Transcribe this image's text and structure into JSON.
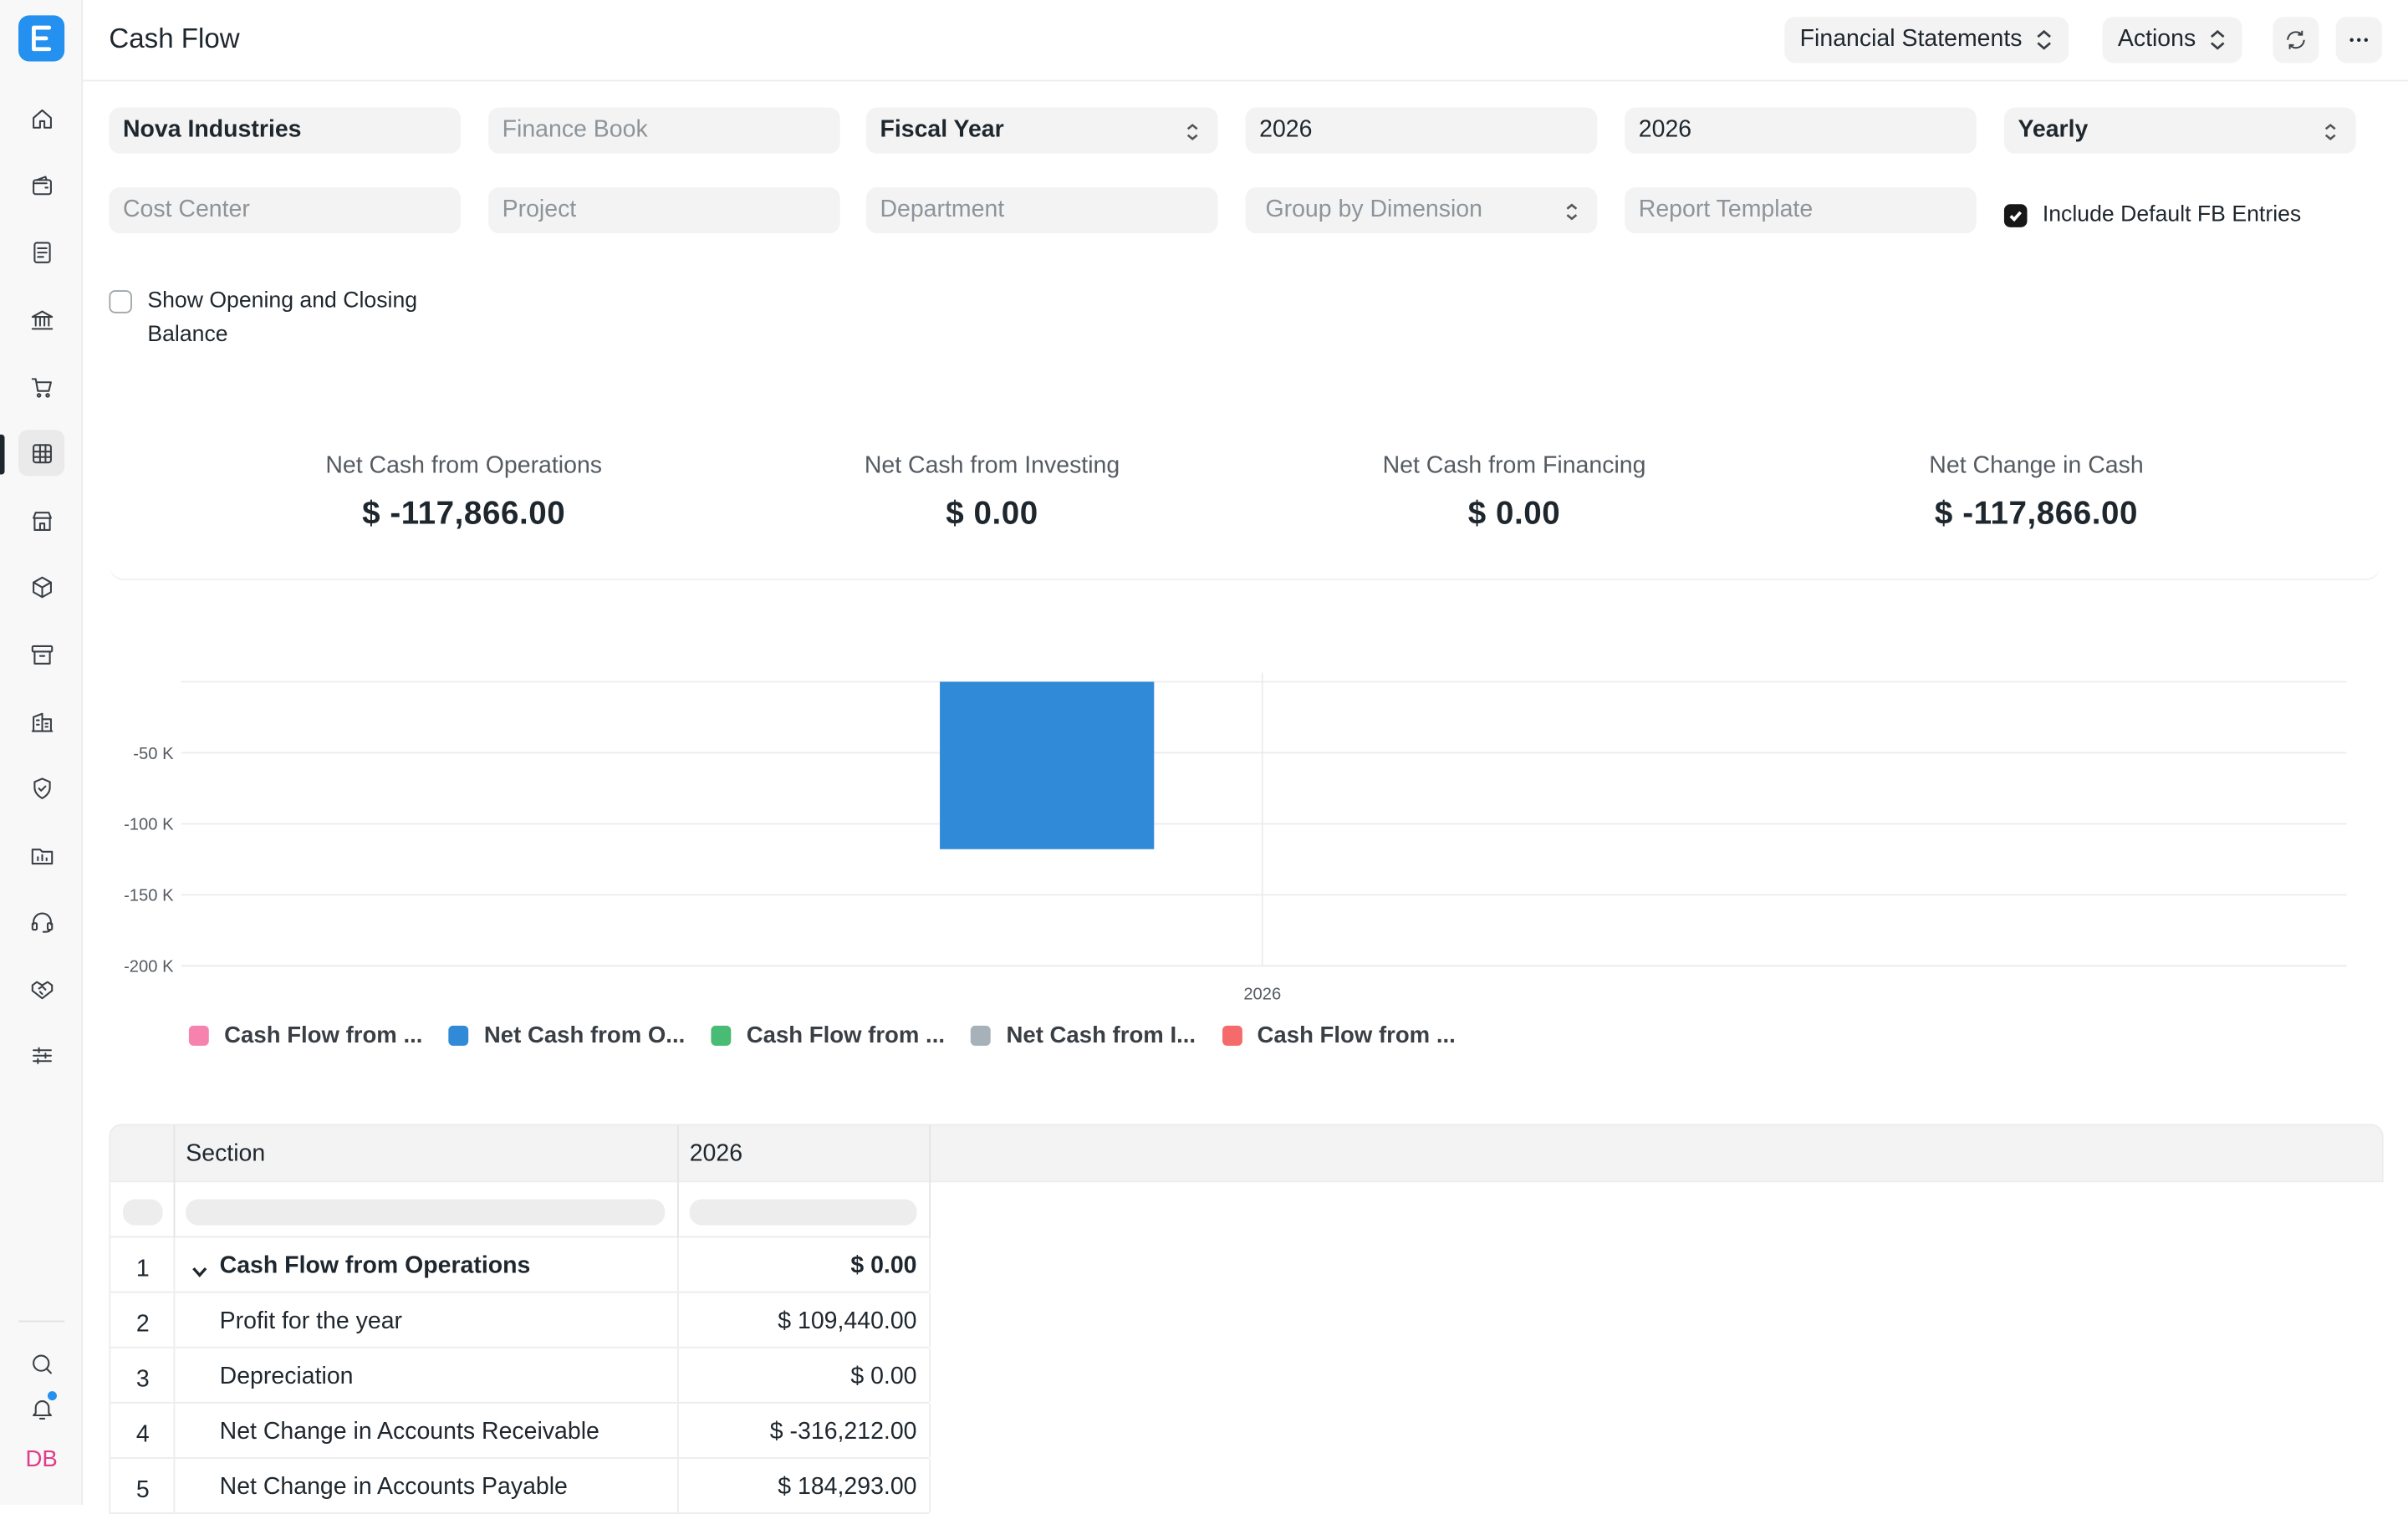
{
  "app": {
    "title": "Cash Flow",
    "avatar_initials": "DB",
    "logo_letter": "E"
  },
  "header": {
    "menu_button": "Financial Statements",
    "actions_button": "Actions",
    "refresh_icon": "refresh-icon",
    "more_icon": "more-horizontal-icon"
  },
  "sidebar": {
    "items": [
      {
        "icon": "home-icon"
      },
      {
        "icon": "wallet-icon"
      },
      {
        "icon": "file-text-icon"
      },
      {
        "icon": "bank-icon"
      },
      {
        "icon": "cart-icon"
      },
      {
        "icon": "table-icon",
        "active": true
      },
      {
        "icon": "store-icon"
      },
      {
        "icon": "box-icon"
      },
      {
        "icon": "archive-icon"
      },
      {
        "icon": "building-icon"
      },
      {
        "icon": "shield-icon"
      },
      {
        "icon": "folder-chart-icon"
      },
      {
        "icon": "headset-icon"
      },
      {
        "icon": "handshake-icon"
      },
      {
        "icon": "sliders-icon"
      }
    ],
    "bottom": [
      {
        "icon": "search-icon"
      },
      {
        "icon": "bell-icon"
      }
    ]
  },
  "filters": {
    "company": "Nova Industries",
    "finance_book_placeholder": "Finance Book",
    "period_type": "Fiscal Year",
    "from_year": "2026",
    "to_year": "2026",
    "periodicity": "Yearly",
    "cost_center_placeholder": "Cost Center",
    "project_placeholder": "Project",
    "department_placeholder": "Department",
    "group_by_placeholder": "Group by Dimension",
    "report_template_placeholder": "Report Template",
    "include_default_fb_label": "Include Default FB Entries",
    "include_default_fb_checked": true,
    "show_opening_closing_label_1": "Show Opening and Closing",
    "show_opening_closing_label_2": "Balance",
    "show_opening_closing_checked": false
  },
  "summary": [
    {
      "label": "Net Cash from Operations",
      "value": "$ -117,866.00"
    },
    {
      "label": "Net Cash from Investing",
      "value": "$ 0.00"
    },
    {
      "label": "Net Cash from Financing",
      "value": "$ 0.00"
    },
    {
      "label": "Net Change in Cash",
      "value": "$ -117,866.00"
    }
  ],
  "chart_data": {
    "type": "bar",
    "categories": [
      "2026"
    ],
    "y_ticks": [
      "-50 K",
      "-100 K",
      "-150 K",
      "-200 K"
    ],
    "ylim": [
      -200000,
      0
    ],
    "grid": true,
    "series": [
      {
        "name": "Cash Flow from ...",
        "values": [
          0
        ],
        "color": "#f683ae"
      },
      {
        "name": "Net Cash from O...",
        "values": [
          -117866
        ],
        "color": "#318ad8"
      },
      {
        "name": "Cash Flow from ...",
        "values": [
          0
        ],
        "color": "#48bb74"
      },
      {
        "name": "Net Cash from I...",
        "values": [
          0
        ],
        "color": "#a6b1b9"
      },
      {
        "name": "Cash Flow from ...",
        "values": [
          0
        ],
        "color": "#f56b6b"
      }
    ]
  },
  "table": {
    "columns": [
      "Section",
      "2026"
    ],
    "rows": [
      {
        "idx": "1",
        "label": "Cash Flow from Operations",
        "value": "$ 0.00",
        "group": true
      },
      {
        "idx": "2",
        "label": "Profit for the year",
        "value": "$ 109,440.00",
        "group": false
      },
      {
        "idx": "3",
        "label": "Depreciation",
        "value": "$ 0.00",
        "group": false
      },
      {
        "idx": "4",
        "label": "Net Change in Accounts Receivable",
        "value": "$ -316,212.00",
        "group": false
      },
      {
        "idx": "5",
        "label": "Net Change in Accounts Payable",
        "value": "$ 184,293.00",
        "group": false
      }
    ]
  }
}
